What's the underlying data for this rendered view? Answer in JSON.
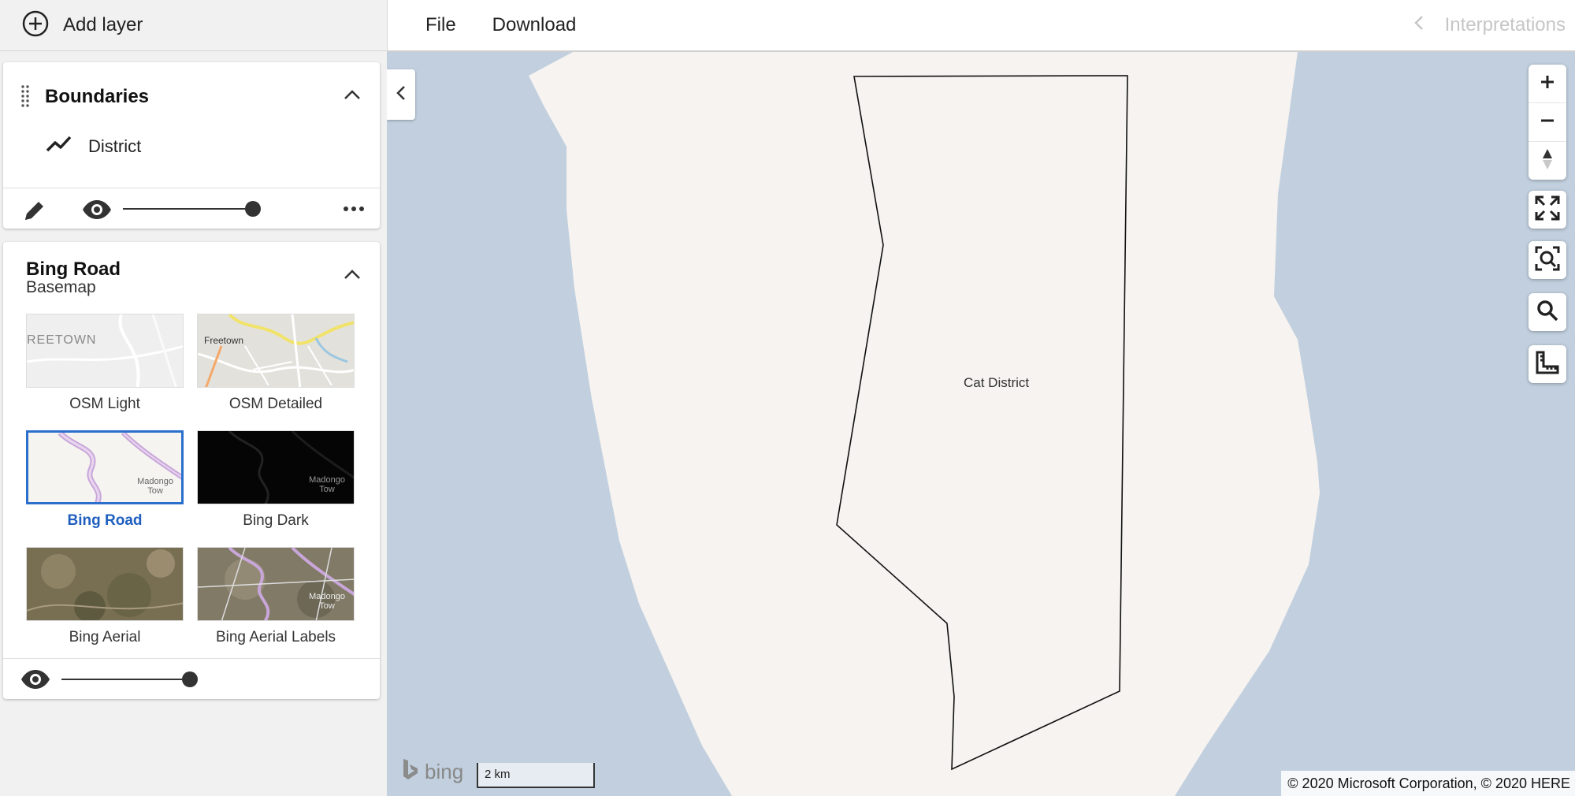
{
  "header": {
    "add_layer_label": "Add layer",
    "menu": {
      "file": "File",
      "download": "Download"
    },
    "interpretations_label": "Interpretations"
  },
  "layers": {
    "boundaries": {
      "title": "Boundaries",
      "sublayer_label": "District",
      "opacity_percent": 100
    },
    "basemap": {
      "title": "Bing Road",
      "subtitle": "Basemap",
      "selected": "Bing Road",
      "options": [
        {
          "label": "OSM Light",
          "thumb_text": "REETOWN"
        },
        {
          "label": "OSM Detailed",
          "thumb_text": "Freetown"
        },
        {
          "label": "Bing Road",
          "thumb_text": "Madongo Tow"
        },
        {
          "label": "Bing Dark",
          "thumb_text": "Madongo Tow"
        },
        {
          "label": "Bing Aerial",
          "thumb_text": ""
        },
        {
          "label": "Bing Aerial Labels",
          "thumb_text": "Madongo Tow"
        }
      ],
      "opacity_percent": 100
    }
  },
  "map": {
    "district_label": "Cat District",
    "bing_logo_text": "bing",
    "scale_label": "2 km",
    "copyright": "© 2020 Microsoft Corporation, © 2020 HERE",
    "colors": {
      "water": "#c1cfde",
      "land": "#f6f3f0",
      "boundary": "#111111"
    }
  }
}
